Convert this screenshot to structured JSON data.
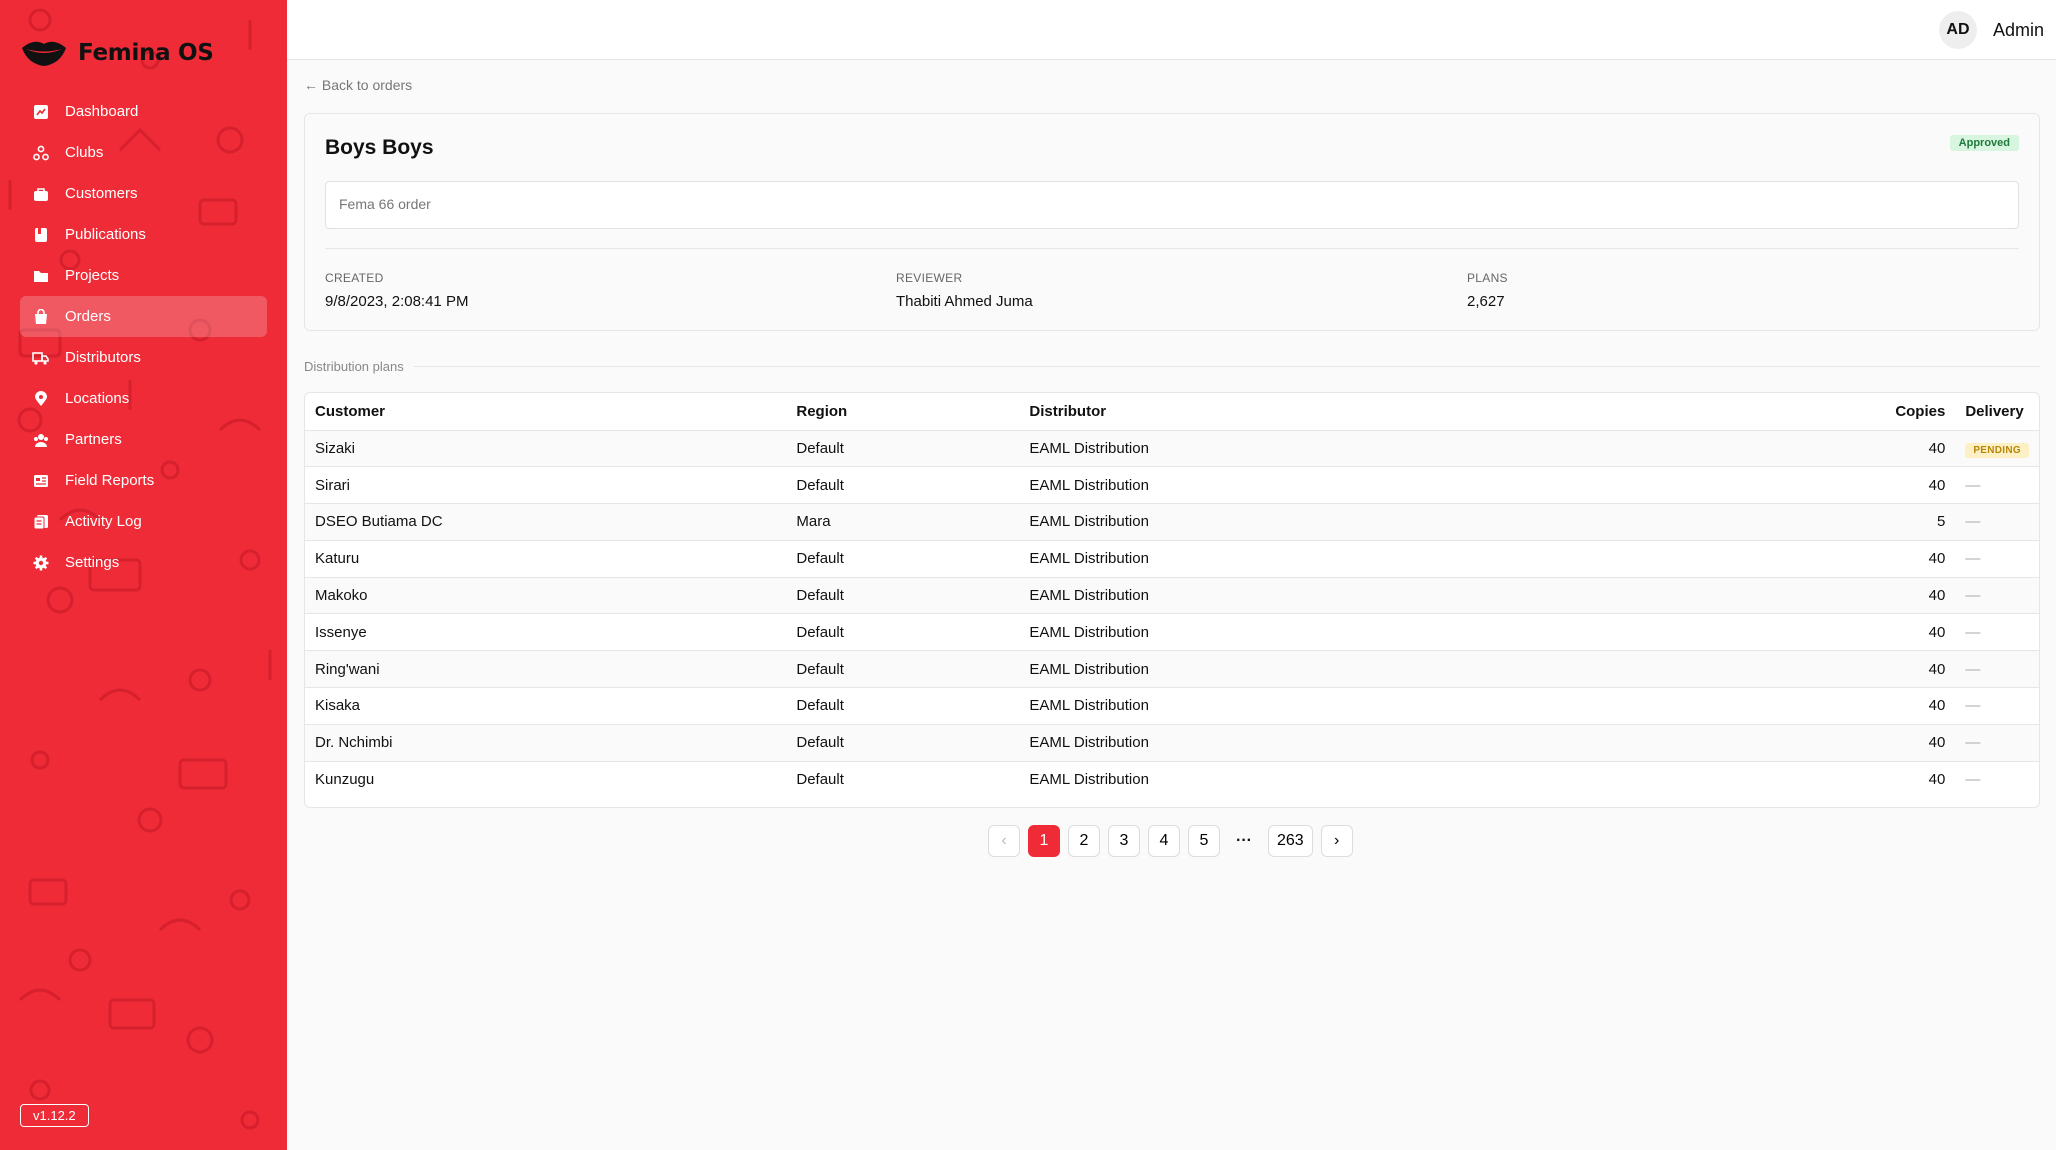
{
  "brand": {
    "name": "Femina OS",
    "accent": "#ee2b37",
    "icon": "lips-logo-icon"
  },
  "sidebar": {
    "items": [
      {
        "label": "Dashboard",
        "icon": "chart-icon"
      },
      {
        "label": "Clubs",
        "icon": "clubs-icon"
      },
      {
        "label": "Customers",
        "icon": "customers-icon"
      },
      {
        "label": "Publications",
        "icon": "book-icon"
      },
      {
        "label": "Projects",
        "icon": "folder-icon"
      },
      {
        "label": "Orders",
        "icon": "bag-icon",
        "active": true
      },
      {
        "label": "Distributors",
        "icon": "truck-icon"
      },
      {
        "label": "Locations",
        "icon": "pin-icon"
      },
      {
        "label": "Partners",
        "icon": "partners-icon"
      },
      {
        "label": "Field Reports",
        "icon": "report-icon"
      },
      {
        "label": "Activity Log",
        "icon": "log-icon"
      },
      {
        "label": "Settings",
        "icon": "gear-icon"
      }
    ],
    "version": "v1.12.2"
  },
  "header": {
    "avatar_initials": "AD",
    "user_name": "Admin"
  },
  "back_link": "← Back to orders",
  "order": {
    "title": "Boys Boys",
    "status": "Approved",
    "note": "Fema 66 order",
    "created_label": "CREATED",
    "created_value": "9/8/2023, 2:08:41 PM",
    "reviewer_label": "REVIEWER",
    "reviewer_value": "Thabiti Ahmed Juma",
    "plans_label": "PLANS",
    "plans_value": "2,627"
  },
  "plans_section_label": "Distribution plans",
  "table": {
    "headers": {
      "customer": "Customer",
      "region": "Region",
      "distributor": "Distributor",
      "copies": "Copies",
      "delivery": "Delivery"
    },
    "rows": [
      {
        "customer": "Sizaki",
        "region": "Default",
        "distributor": "EAML Distribution",
        "copies": "40",
        "delivery": "PENDING"
      },
      {
        "customer": "Sirari",
        "region": "Default",
        "distributor": "EAML Distribution",
        "copies": "40",
        "delivery": "—"
      },
      {
        "customer": "DSEO Butiama DC",
        "region": "Mara",
        "distributor": "EAML Distribution",
        "copies": "5",
        "delivery": "—"
      },
      {
        "customer": "Katuru",
        "region": "Default",
        "distributor": "EAML Distribution",
        "copies": "40",
        "delivery": "—"
      },
      {
        "customer": "Makoko",
        "region": "Default",
        "distributor": "EAML Distribution",
        "copies": "40",
        "delivery": "—"
      },
      {
        "customer": "Issenye",
        "region": "Default",
        "distributor": "EAML Distribution",
        "copies": "40",
        "delivery": "—"
      },
      {
        "customer": "Ring'wani",
        "region": "Default",
        "distributor": "EAML Distribution",
        "copies": "40",
        "delivery": "—"
      },
      {
        "customer": "Kisaka",
        "region": "Default",
        "distributor": "EAML Distribution",
        "copies": "40",
        "delivery": "—"
      },
      {
        "customer": "Dr. Nchimbi",
        "region": "Default",
        "distributor": "EAML Distribution",
        "copies": "40",
        "delivery": "—"
      },
      {
        "customer": "Kunzugu",
        "region": "Default",
        "distributor": "EAML Distribution",
        "copies": "40",
        "delivery": "—"
      }
    ]
  },
  "pagination": {
    "prev": "‹",
    "pages": [
      "1",
      "2",
      "3",
      "4",
      "5"
    ],
    "current": "1",
    "ellipsis": "···",
    "last": "263",
    "next": "›"
  }
}
